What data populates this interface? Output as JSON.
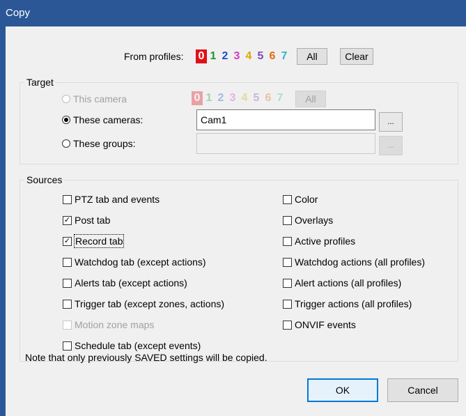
{
  "window": {
    "title": "Copy"
  },
  "profiles": {
    "label": "From profiles:",
    "digits": [
      {
        "text": "0",
        "color": "#ffffff",
        "selected": true
      },
      {
        "text": "1",
        "color": "#1a9a2a"
      },
      {
        "text": "2",
        "color": "#1a4fc9"
      },
      {
        "text": "3",
        "color": "#d63bbf"
      },
      {
        "text": "4",
        "color": "#d9a900"
      },
      {
        "text": "5",
        "color": "#7b4db8"
      },
      {
        "text": "6",
        "color": "#e06a10"
      },
      {
        "text": "7",
        "color": "#33b3c8"
      }
    ],
    "all_label": "All",
    "clear_label": "Clear"
  },
  "target": {
    "title": "Target",
    "this_camera": "This camera",
    "these_cameras": "These cameras:",
    "these_groups": "These groups:",
    "cameras_value": "Cam1",
    "groups_value": "",
    "all_label": "All",
    "browse_label": "...",
    "selected": "these_cameras"
  },
  "sources": {
    "title": "Sources",
    "left": [
      {
        "label": "PTZ tab and events",
        "checked": false,
        "disabled": false
      },
      {
        "label": "Post tab",
        "checked": true,
        "disabled": false
      },
      {
        "label": "Record tab",
        "checked": true,
        "disabled": false,
        "focused": true
      },
      {
        "label": "Watchdog tab (except actions)",
        "checked": false,
        "disabled": false
      },
      {
        "label": "Alerts tab (except actions)",
        "checked": false,
        "disabled": false
      },
      {
        "label": "Trigger tab (except zones, actions)",
        "checked": false,
        "disabled": false
      },
      {
        "label": "Motion zone maps",
        "checked": false,
        "disabled": true
      },
      {
        "label": "Schedule tab (except events)",
        "checked": false,
        "disabled": false
      }
    ],
    "right": [
      {
        "label": "Color",
        "checked": false
      },
      {
        "label": "Overlays",
        "checked": false
      },
      {
        "label": "Active profiles",
        "checked": false
      },
      {
        "label": "Watchdog actions (all profiles)",
        "checked": false
      },
      {
        "label": "Alert actions (all profiles)",
        "checked": false
      },
      {
        "label": "Trigger actions (all profiles)",
        "checked": false
      },
      {
        "label": "ONVIF events",
        "checked": false
      }
    ]
  },
  "footer": {
    "note": "Note that only previously SAVED settings will be copied.",
    "ok_label": "OK",
    "cancel_label": "Cancel"
  }
}
